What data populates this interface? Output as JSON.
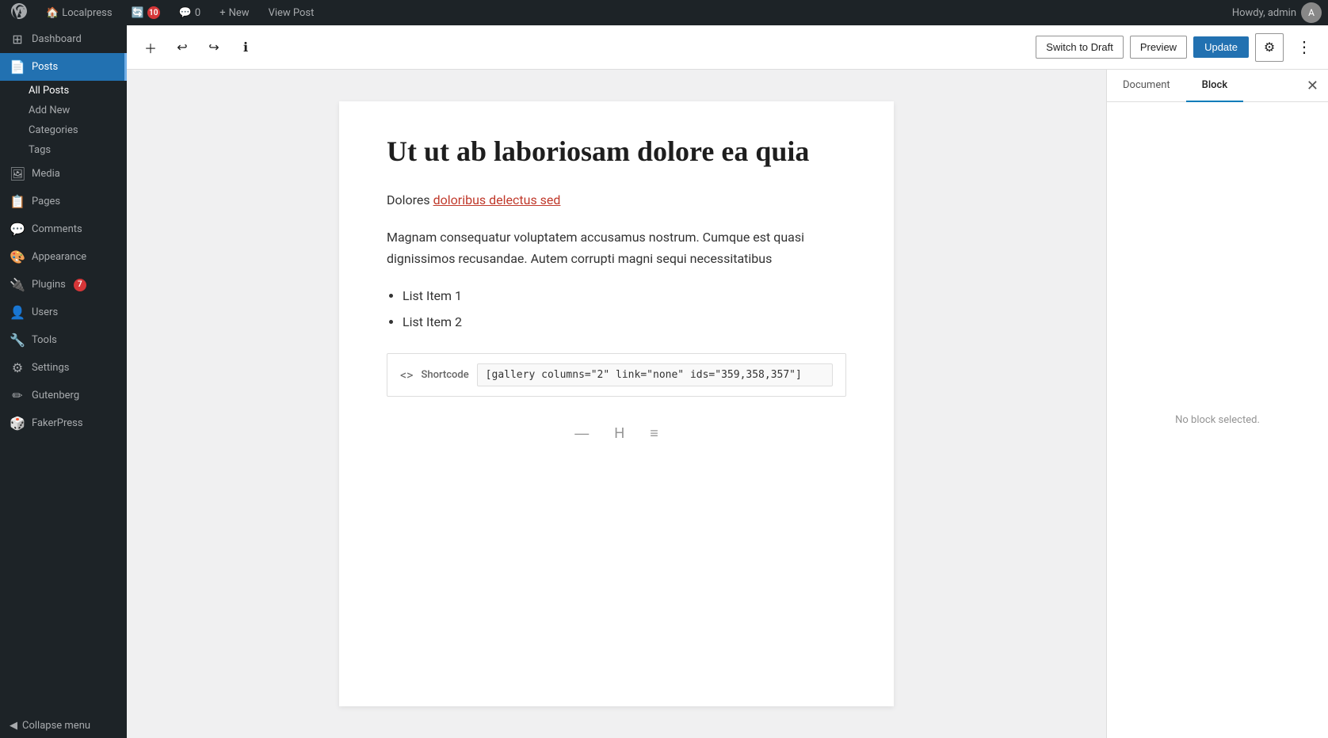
{
  "adminBar": {
    "siteName": "Localpress",
    "updateCount": "10",
    "commentCount": "0",
    "newLabel": "New",
    "viewPostLabel": "View Post",
    "howdy": "Howdy, admin"
  },
  "sidebar": {
    "items": [
      {
        "id": "dashboard",
        "label": "Dashboard",
        "icon": "⊞"
      },
      {
        "id": "posts",
        "label": "Posts",
        "icon": "📄",
        "active": true
      },
      {
        "id": "media",
        "label": "Media",
        "icon": "🖼"
      },
      {
        "id": "pages",
        "label": "Pages",
        "icon": "📋"
      },
      {
        "id": "comments",
        "label": "Comments",
        "icon": "💬"
      },
      {
        "id": "appearance",
        "label": "Appearance",
        "icon": "🎨"
      },
      {
        "id": "plugins",
        "label": "Plugins",
        "icon": "🔌",
        "badge": "7"
      },
      {
        "id": "users",
        "label": "Users",
        "icon": "👤"
      },
      {
        "id": "tools",
        "label": "Tools",
        "icon": "🔧"
      },
      {
        "id": "settings",
        "label": "Settings",
        "icon": "⚙"
      },
      {
        "id": "gutenberg",
        "label": "Gutenberg",
        "icon": "✏"
      },
      {
        "id": "fakerpress",
        "label": "FakerPress",
        "icon": "🎲"
      }
    ],
    "postsSubItems": [
      {
        "id": "all-posts",
        "label": "All Posts",
        "active": true
      },
      {
        "id": "add-new",
        "label": "Add New"
      },
      {
        "id": "categories",
        "label": "Categories"
      },
      {
        "id": "tags",
        "label": "Tags"
      }
    ],
    "collapseMenu": "Collapse menu"
  },
  "toolbar": {
    "switchToDraft": "Switch to Draft",
    "preview": "Preview",
    "update": "Update"
  },
  "rightPanel": {
    "tabs": [
      "Document",
      "Block"
    ],
    "activeTab": "Block",
    "noBlockMessage": "No block selected."
  },
  "post": {
    "title": "Ut ut ab laboriosam dolore ea quia",
    "paragraphs": [
      {
        "text": "Dolores ",
        "linkText": "doloribus delectus sed",
        "linkHref": "#"
      },
      {
        "text": "Magnam consequatur voluptatem accusamus nostrum. Cumque est quasi dignissimos recusandae. Autem corrupti magni sequi necessitatibus"
      }
    ],
    "listItems": [
      "List Item 1",
      "List Item 2"
    ],
    "shortcode": {
      "label": "Shortcode",
      "value": "[gallery columns=\"2\" link=\"none\" ids=\"359,358,357\"]"
    }
  },
  "inserterBar": {
    "dashIcon": "—",
    "headingIcon": "H",
    "listIcon": "≡"
  }
}
